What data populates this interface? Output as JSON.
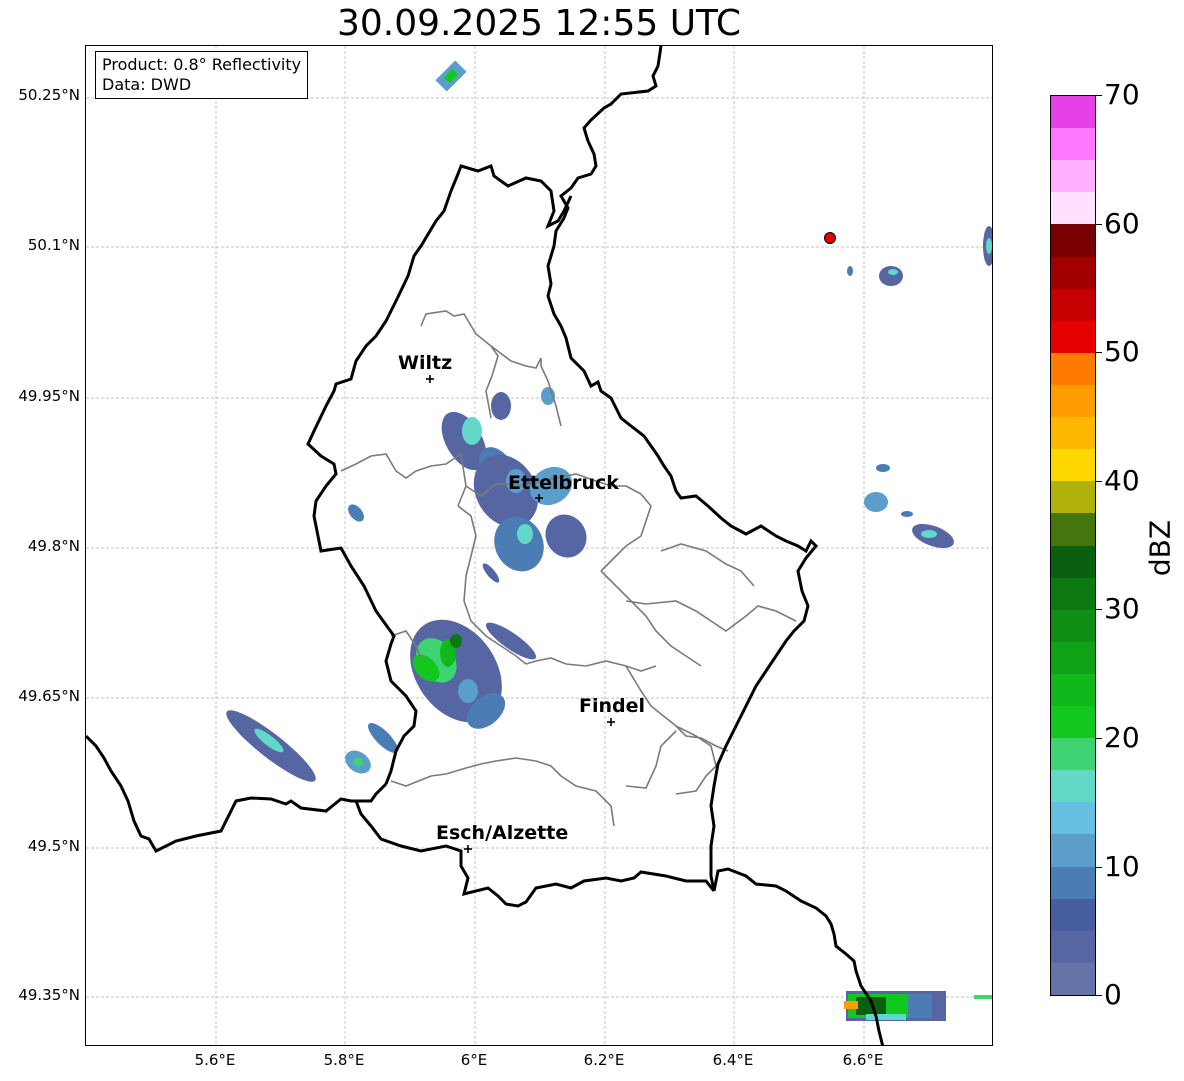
{
  "title": "30.09.2025 12:55 UTC",
  "info_box": {
    "product": "Product: 0.8° Reflectivity",
    "data": "Data: DWD"
  },
  "map": {
    "lat_ticks": [
      "50.25°N",
      "50.1°N",
      "49.95°N",
      "49.8°N",
      "49.65°N",
      "49.5°N",
      "49.35°N"
    ],
    "lon_ticks": [
      "5.6°E",
      "5.8°E",
      "6°E",
      "6.2°E",
      "6.4°E",
      "6.6°E"
    ],
    "cities": [
      {
        "name": "Wiltz"
      },
      {
        "name": "Ettelbruck"
      },
      {
        "name": "Findel"
      },
      {
        "name": "Esch/Alzette"
      }
    ],
    "marker_color": "#e00000",
    "gridlines": true
  },
  "colorbar": {
    "label": "dBZ",
    "ticks": [
      "0",
      "10",
      "20",
      "30",
      "40",
      "50",
      "60",
      "70"
    ],
    "colors": [
      "#6573a8",
      "#5666a3",
      "#465d9f",
      "#4b7cb3",
      "#5a9ec9",
      "#66bfe0",
      "#62d8c8",
      "#3ed474",
      "#12c81e",
      "#11b81b",
      "#0fa217",
      "#0e8f14",
      "#0c7811",
      "#086010",
      "#45750f",
      "#b0b10c",
      "#ffd700",
      "#ffb800",
      "#ff9c00",
      "#ff7a00",
      "#e60000",
      "#c40000",
      "#a20000",
      "#780000",
      "#ffe0ff",
      "#ffb0ff",
      "#ff77ff",
      "#e840e8"
    ]
  }
}
